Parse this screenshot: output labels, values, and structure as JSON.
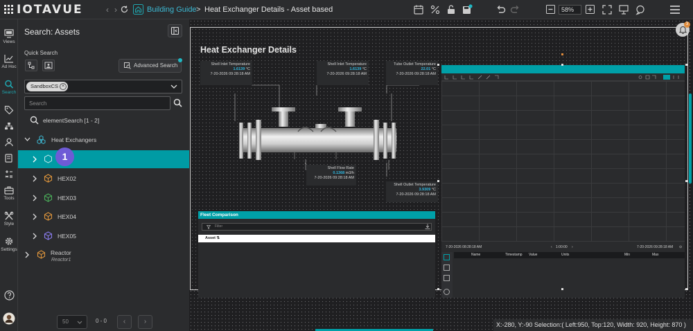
{
  "app": {
    "logo_text": "IOTAVUE"
  },
  "breadcrumb": {
    "parent": "Building Guide",
    "separator": ">",
    "current": "Heat Exchanger Details - Asset based"
  },
  "toolbar": {
    "zoom": "58%"
  },
  "rail": {
    "items": [
      {
        "label": "Views",
        "icon": "views-icon"
      },
      {
        "label": "Ad Hoc",
        "icon": "trend-icon"
      },
      {
        "label": "Search",
        "icon": "search-icon",
        "active": true
      },
      {
        "label": "",
        "icon": "tag-icon"
      },
      {
        "label": "",
        "icon": "hierarchy-icon"
      },
      {
        "label": "",
        "icon": "user-icon"
      },
      {
        "label": "",
        "icon": "storage-icon"
      },
      {
        "label": "",
        "icon": "calculator-icon"
      },
      {
        "label": "Tools",
        "icon": "toolbox-icon"
      },
      {
        "label": "Style",
        "icon": "style-icon"
      },
      {
        "label": "Settings",
        "icon": "gear-icon"
      }
    ],
    "help_icon": "help-icon"
  },
  "search_panel": {
    "title": "Search: Assets",
    "quick_search_label": "Quick Search",
    "advanced_search_label": "Advanced Search",
    "database_chip": "SandboxCS",
    "search_placeholder": "Search",
    "result_label": "elementSearch [1 - 2]",
    "tree": {
      "root": "Heat Exchangers",
      "children": [
        {
          "label": "",
          "selected": true
        },
        {
          "label": "HEX02"
        },
        {
          "label": "HEX03"
        },
        {
          "label": "HEX04"
        },
        {
          "label": "HEX05"
        }
      ],
      "sibling": {
        "label": "Reactor",
        "sublabel": "Reactor1"
      }
    },
    "step_badge": "1",
    "pager": {
      "page_size": "50",
      "range": "0 - 0",
      "prev": "‹",
      "next": "›"
    }
  },
  "display": {
    "title": "Heat Exchanger Details",
    "kpis": [
      {
        "label": "Shell Inlet Temperature",
        "value": "1.6139",
        "unit": "°C",
        "time": "7-20-2026 09:28:18 AM"
      },
      {
        "label": "Shell Inlet Temperature",
        "value": "1.6139",
        "unit": "°C",
        "time": "7-20-2026 09:28:18 AM"
      },
      {
        "label": "Tube Outlet Temperature",
        "value": "22.01",
        "unit": "°C",
        "time": "7-20-2026 09:28:18 AM"
      },
      {
        "label": "Shell Flow Rate",
        "value": "0.1368",
        "unit": "m3/h",
        "time": "7-20-2026 09:28:18 AM"
      },
      {
        "label": "Shell Outlet Temperature",
        "value": "3.9309",
        "unit": "°C",
        "time": "7-20-2026 09:28:18 AM"
      }
    ],
    "fleet": {
      "title": "Fleet Comparison",
      "filter_placeholder": "Filter",
      "column": "Asset ⇅"
    },
    "trend": {
      "start": "7-20-2026 08:28:18 AM",
      "duration": "1:00:00",
      "end": "7-20-2026 09:28:18 AM",
      "columns": [
        "Name",
        "Timestamp",
        "Value",
        "Units",
        "Min",
        "Max"
      ]
    }
  },
  "notifications": {
    "count": "3"
  },
  "status": {
    "text": "X:-280, Y:-90  Selection:( Left:950, Top:120, Width: 920, Height: 870 )"
  },
  "colors": {
    "accent": "#009ba4",
    "badge": "#6e5bd6",
    "value": "#2fb8e0"
  }
}
